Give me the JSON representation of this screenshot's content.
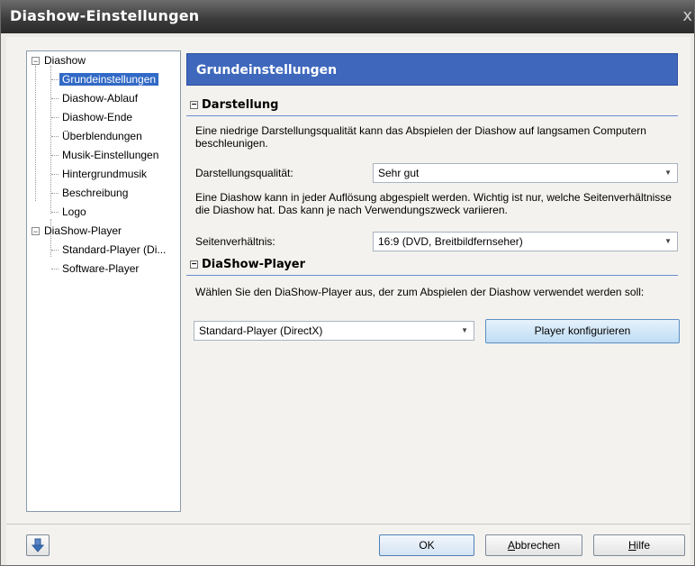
{
  "window": {
    "title": "Diashow-Einstellungen",
    "close_glyph": "x"
  },
  "tree": {
    "items": [
      {
        "label": "Diashow",
        "expander": "−"
      },
      {
        "label": "Grundeinstellungen"
      },
      {
        "label": "Diashow-Ablauf"
      },
      {
        "label": "Diashow-Ende"
      },
      {
        "label": "Überblendungen"
      },
      {
        "label": "Musik-Einstellungen"
      },
      {
        "label": "Hintergrundmusik"
      },
      {
        "label": "Beschreibung"
      },
      {
        "label": "Logo"
      },
      {
        "label": "DiaShow-Player",
        "expander": "−"
      },
      {
        "label": "Standard-Player (Di..."
      },
      {
        "label": "Software-Player"
      }
    ]
  },
  "panel": {
    "header": "Grundeinstellungen",
    "sections": [
      {
        "toggle": "−",
        "title": "Darstellung"
      },
      {
        "toggle": "−",
        "title": "DiaShow-Player"
      }
    ],
    "darstellung_text": "Eine niedrige Darstellungsqualität kann das Abspielen der Diashow auf langsamen Computern beschleunigen.",
    "quality_label": "Darstellungsqualität:",
    "quality_value": "Sehr gut",
    "resolution_text": "Eine Diashow kann in jeder Auflösung abgespielt werden. Wichtig ist nur, welche Seitenverhältnisse die Diashow hat. Das kann je nach Verwendungszweck variieren.",
    "ratio_label": "Seitenverhältnis:",
    "ratio_value": "16:9 (DVD, Breitbildfernseher)",
    "player_text": "Wählen Sie den DiaShow-Player aus, der zum Abspielen der Diashow verwendet werden soll:",
    "player_value": "Standard-Player (DirectX)",
    "configure_button": "Player konfigurieren"
  },
  "footer": {
    "ok": "OK",
    "cancel_first": "A",
    "cancel_rest": "bbrechen",
    "help_first": "H",
    "help_rest": "ilfe",
    "pin_icon": "pin-icon"
  },
  "dropdown_arrow": "▼"
}
